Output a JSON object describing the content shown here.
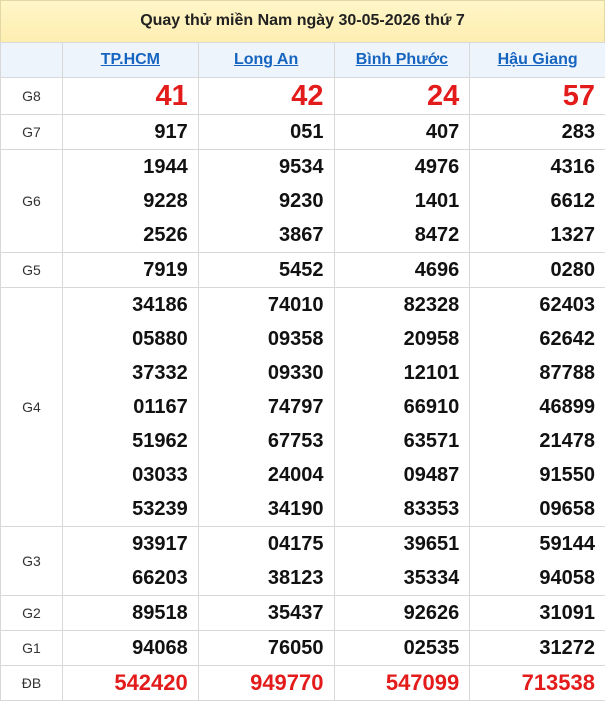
{
  "title": "Quay thử miền Nam ngày 30-05-2026 thứ 7",
  "provinces": [
    "TP.HCM",
    "Long An",
    "Bình Phước",
    "Hậu Giang"
  ],
  "prizes": [
    {
      "label": "G8",
      "values": [
        [
          "41"
        ],
        [
          "42"
        ],
        [
          "24"
        ],
        [
          "57"
        ]
      ]
    },
    {
      "label": "G7",
      "values": [
        [
          "917"
        ],
        [
          "051"
        ],
        [
          "407"
        ],
        [
          "283"
        ]
      ]
    },
    {
      "label": "G6",
      "values": [
        [
          "1944",
          "9228",
          "2526"
        ],
        [
          "9534",
          "9230",
          "3867"
        ],
        [
          "4976",
          "1401",
          "8472"
        ],
        [
          "4316",
          "6612",
          "1327"
        ]
      ]
    },
    {
      "label": "G5",
      "values": [
        [
          "7919"
        ],
        [
          "5452"
        ],
        [
          "4696"
        ],
        [
          "0280"
        ]
      ]
    },
    {
      "label": "G4",
      "values": [
        [
          "34186",
          "05880",
          "37332",
          "01167",
          "51962",
          "03033",
          "53239"
        ],
        [
          "74010",
          "09358",
          "09330",
          "74797",
          "67753",
          "24004",
          "34190"
        ],
        [
          "82328",
          "20958",
          "12101",
          "66910",
          "63571",
          "09487",
          "83353"
        ],
        [
          "62403",
          "62642",
          "87788",
          "46899",
          "21478",
          "91550",
          "09658"
        ]
      ]
    },
    {
      "label": "G3",
      "values": [
        [
          "93917",
          "66203"
        ],
        [
          "04175",
          "38123"
        ],
        [
          "39651",
          "35334"
        ],
        [
          "59144",
          "94058"
        ]
      ]
    },
    {
      "label": "G2",
      "values": [
        [
          "89518"
        ],
        [
          "35437"
        ],
        [
          "92626"
        ],
        [
          "31091"
        ]
      ]
    },
    {
      "label": "G1",
      "values": [
        [
          "94068"
        ],
        [
          "76050"
        ],
        [
          "02535"
        ],
        [
          "31272"
        ]
      ]
    },
    {
      "label": "ĐB",
      "values": [
        [
          "542420"
        ],
        [
          "949770"
        ],
        [
          "547099"
        ],
        [
          "713538"
        ]
      ]
    }
  ],
  "colors": {
    "accent_red": "#e31b1b",
    "province_link": "#1565c0",
    "header_bg": "#fdeeb1"
  }
}
